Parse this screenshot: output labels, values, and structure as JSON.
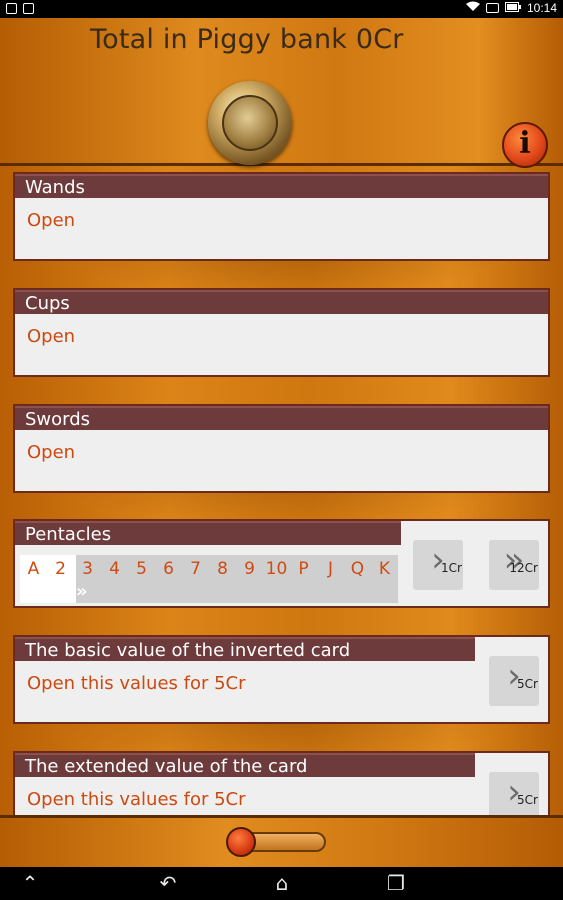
{
  "status_bar": {
    "time": "10:14",
    "left_icons": [
      "notification-icon",
      "image-icon"
    ],
    "right_icons": [
      "wifi-icon",
      "image-icon",
      "battery-icon"
    ]
  },
  "header": {
    "title": "Total in Piggy bank 0Cr",
    "info_label": "i"
  },
  "sections": {
    "wands": {
      "title": "Wands",
      "link": "Open"
    },
    "cups": {
      "title": "Cups",
      "link": "Open"
    },
    "swords": {
      "title": "Swords",
      "link": "Open"
    },
    "pentacles": {
      "title": "Pentacles",
      "letters": [
        "A",
        "2",
        "3",
        "4",
        "5",
        "6",
        "7",
        "8",
        "9",
        "10",
        "P",
        "J",
        "Q",
        "K"
      ],
      "next_price": "1Cr",
      "fast_next_price": "12Cr"
    },
    "basic_inverted": {
      "title": "The basic value of the inverted card",
      "link": "Open this values for 5Cr",
      "price": "5Cr"
    },
    "extended": {
      "title": "The extended value of the card",
      "link": "Open this values for 5Cr",
      "price": "5Cr"
    }
  },
  "symbols": {
    "chevron": "›",
    "double_chevron": "»",
    "indicator": "»"
  },
  "nav": {
    "back": "↶",
    "home": "⌂",
    "recents": "❐",
    "up": "⌃"
  },
  "colors": {
    "accent": "#cc4a10",
    "header_bar": "#6d3b3b",
    "background": "#c9700f"
  }
}
